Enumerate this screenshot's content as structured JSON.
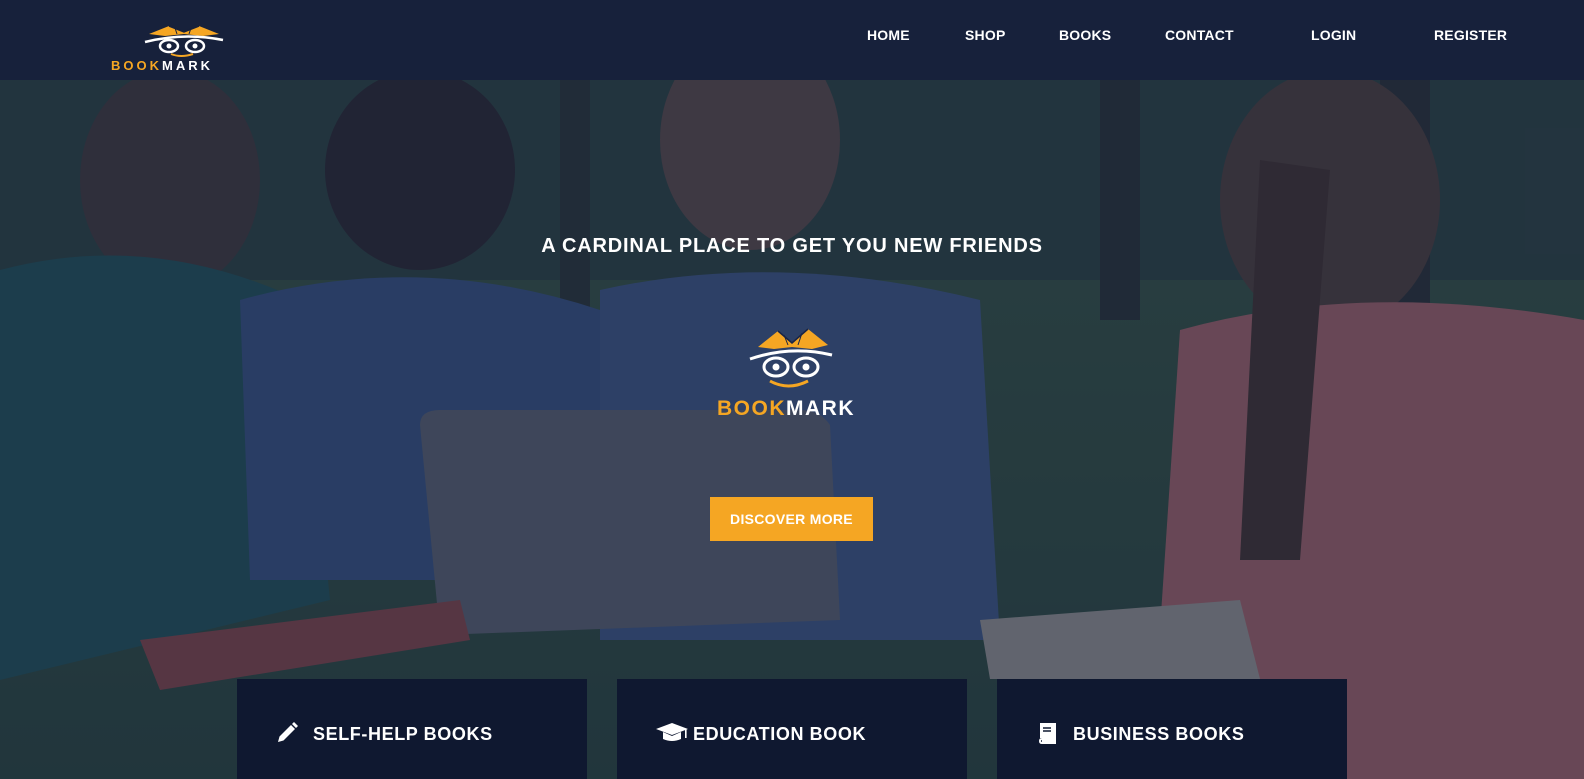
{
  "brand": {
    "name_part1": "BOOK",
    "name_part2": "MARK",
    "accent_color": "#f5a623",
    "header_bg": "#17213b",
    "card_bg": "#0f1830"
  },
  "nav": {
    "items": [
      {
        "label": "HOME"
      },
      {
        "label": "SHOP"
      },
      {
        "label": "BOOKS"
      },
      {
        "label": "CONTACT"
      },
      {
        "label": "LOGIN"
      },
      {
        "label": "REGISTER"
      }
    ]
  },
  "hero": {
    "tagline": "A CARDINAL PLACE TO GET YOU NEW FRIENDS",
    "cta_label": "DISCOVER MORE"
  },
  "categories": [
    {
      "label": "SELF-HELP BOOKS",
      "icon": "pencil-icon"
    },
    {
      "label": "EDUCATION BOOK",
      "icon": "graduation-cap-icon"
    },
    {
      "label": "BUSINESS BOOKS",
      "icon": "book-icon"
    }
  ]
}
